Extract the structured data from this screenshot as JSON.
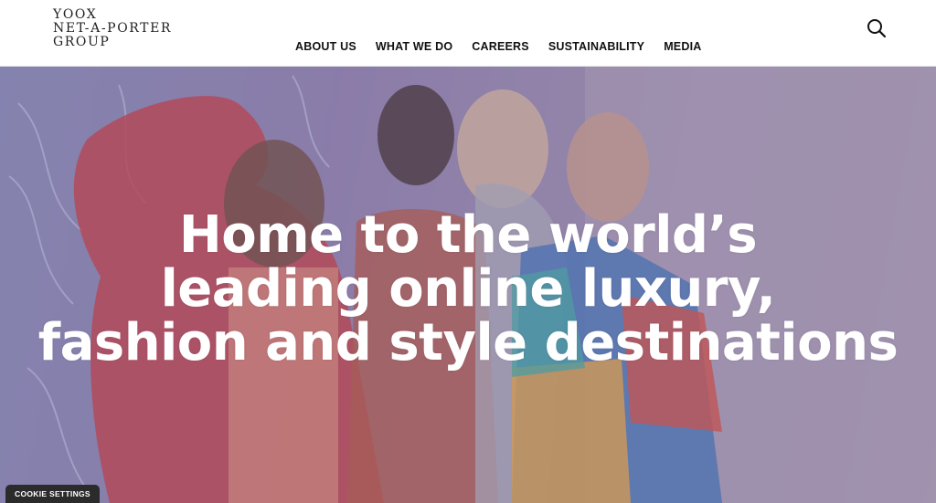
{
  "header": {
    "logo_lines": [
      "YOOX",
      "NET-A-PORTER",
      "GROUP"
    ],
    "nav": [
      "ABOUT US",
      "WHAT WE DO",
      "CAREERS",
      "SUSTAINABILITY",
      "MEDIA"
    ],
    "search_icon": "search-icon"
  },
  "hero": {
    "headline_lines": [
      "Home to the world’s",
      "leading online luxury,",
      "fashion and style destinations"
    ]
  },
  "cookie": {
    "label": "COOKIE SETTINGS"
  },
  "colors": {
    "header_bg": "#ffffff",
    "hero_tint": "#8a7aa8",
    "headline": "#ffffff",
    "cookie_bg": "#2b2b2b"
  }
}
